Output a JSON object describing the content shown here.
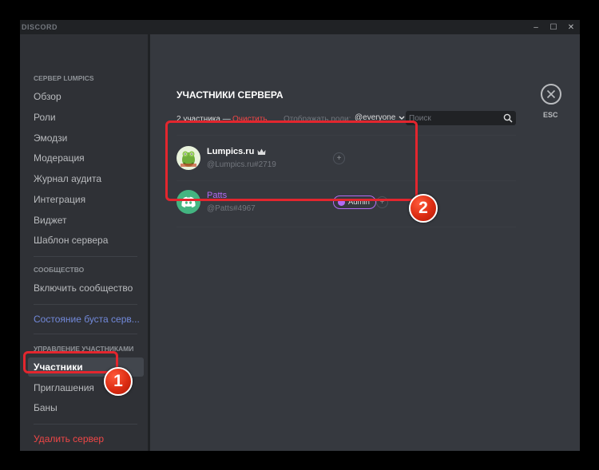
{
  "window": {
    "app_title": "DISCORD",
    "controls": {
      "minimize": "–",
      "maximize": "☐",
      "close": "✕"
    }
  },
  "sidebar": {
    "server_section": "СЕРВЕР LUMPICS",
    "server_items": [
      {
        "label": "Обзор"
      },
      {
        "label": "Роли"
      },
      {
        "label": "Эмодзи"
      },
      {
        "label": "Модерация"
      },
      {
        "label": "Журнал аудита"
      },
      {
        "label": "Интеграция"
      },
      {
        "label": "Виджет"
      },
      {
        "label": "Шаблон сервера"
      }
    ],
    "community_section": "СООБЩЕСТВО",
    "community_items": [
      {
        "label": "Включить сообщество"
      }
    ],
    "boost_item": "Состояние буста серв...",
    "members_section": "УПРАВЛЕНИЕ УЧАСТНИКАМИ",
    "members_items": [
      {
        "label": "Участники",
        "selected": true
      },
      {
        "label": "Приглашения"
      },
      {
        "label": "Баны"
      }
    ],
    "delete_server": "Удалить сервер"
  },
  "main": {
    "title": "УЧАСТНИКИ СЕРВЕРА",
    "member_count": "2 участника —",
    "clear_label": "Очистить",
    "role_filter_label": "Отображать роли:",
    "role_filter_value": "@everyone",
    "search_placeholder": "Поиск",
    "members": [
      {
        "name": "Lumpics.ru",
        "tag": "@Lumpics.ru#2719",
        "owner": true,
        "roles": []
      },
      {
        "name": "Patts",
        "tag": "@Patts#4967",
        "owner": false,
        "roles": [
          {
            "name": "Admin",
            "color": "#b36bf5"
          }
        ]
      }
    ],
    "add_role_symbol": "+",
    "close_label": "ESC"
  },
  "annotations": {
    "badge_1": "1",
    "badge_2": "2"
  },
  "colors": {
    "background": "#36393f",
    "sidebar": "#2f3136",
    "accent": "#7289da",
    "danger": "#f04747",
    "highlight": "#e3262e",
    "discord_blurple": "#43b581"
  }
}
